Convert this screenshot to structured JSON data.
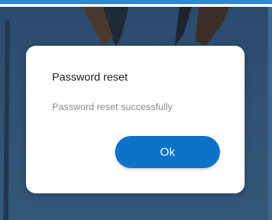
{
  "dialog": {
    "title": "Password reset",
    "message": "Password reset successfully",
    "ok_label": "Ok"
  },
  "colors": {
    "accent": "#0a73c9",
    "backdrop": "#2f5072",
    "top_bar": "#2a88d4"
  }
}
